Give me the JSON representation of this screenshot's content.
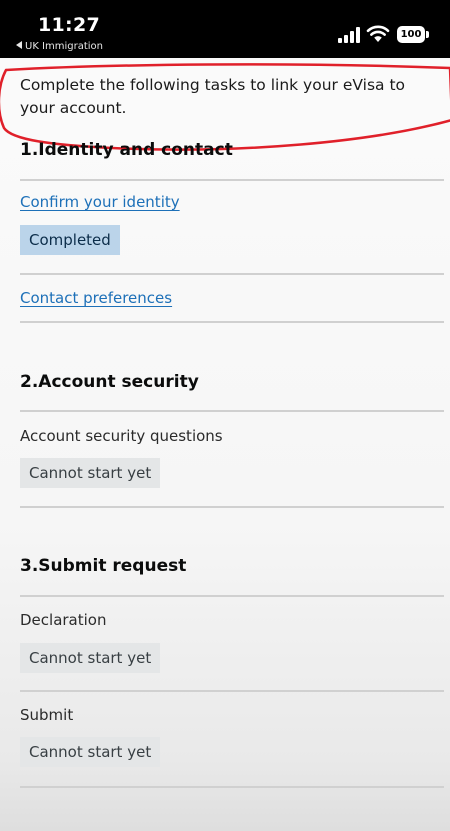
{
  "status_bar": {
    "time": "11:27",
    "back_app": "UK Immigration",
    "battery": "100"
  },
  "intro_text": "Complete the following tasks to link your eVisa to your account.",
  "sections": [
    {
      "heading": "1.Identity and contact",
      "tasks": [
        {
          "title": "Confirm your identity",
          "status": "Completed"
        },
        {
          "title": "Contact preferences"
        }
      ]
    },
    {
      "heading": "2.Account security",
      "tasks": [
        {
          "title": "Account security questions",
          "status": "Cannot start yet"
        }
      ]
    },
    {
      "heading": "3.Submit request",
      "tasks": [
        {
          "title": "Declaration",
          "status": "Cannot start yet"
        },
        {
          "title": "Submit",
          "status": "Cannot start yet"
        }
      ]
    }
  ],
  "colors": {
    "link": "#1d70b8",
    "completed_tag_bg": "#bbd4ea",
    "pending_tag_bg": "#e4e6e7",
    "annotation": "#e0202a"
  }
}
